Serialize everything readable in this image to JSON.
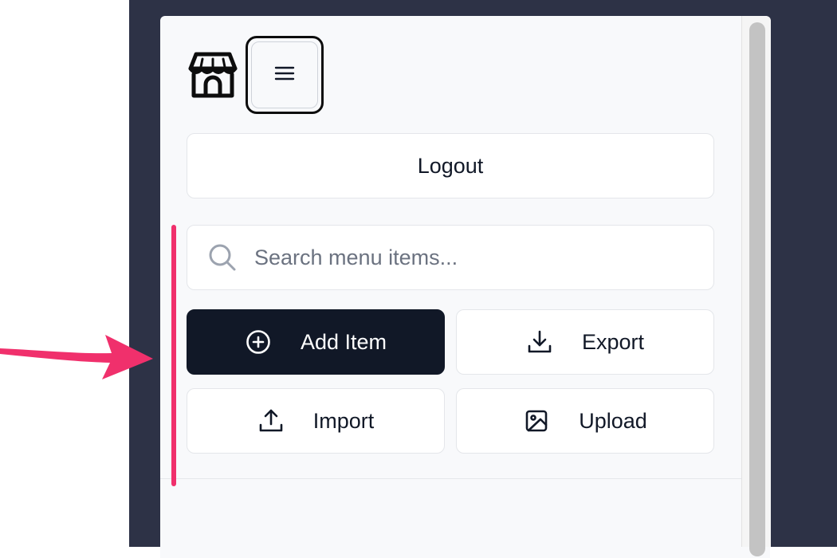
{
  "header": {
    "logo_icon": "store-icon",
    "menu_toggle_icon": "hamburger-menu-icon"
  },
  "logout": {
    "label": "Logout"
  },
  "search": {
    "placeholder": "Search menu items...",
    "value": "",
    "icon": "search-icon"
  },
  "actions": {
    "add_item": {
      "label": "Add Item",
      "icon": "plus-circle-icon"
    },
    "export": {
      "label": "Export",
      "icon": "download-icon"
    },
    "import": {
      "label": "Import",
      "icon": "upload-icon"
    },
    "upload": {
      "label": "Upload",
      "icon": "image-icon"
    }
  },
  "colors": {
    "backdrop": "#2d3246",
    "panel": "#f8f9fb",
    "primary_button": "#111827",
    "annotation_pink": "#f0306c"
  }
}
